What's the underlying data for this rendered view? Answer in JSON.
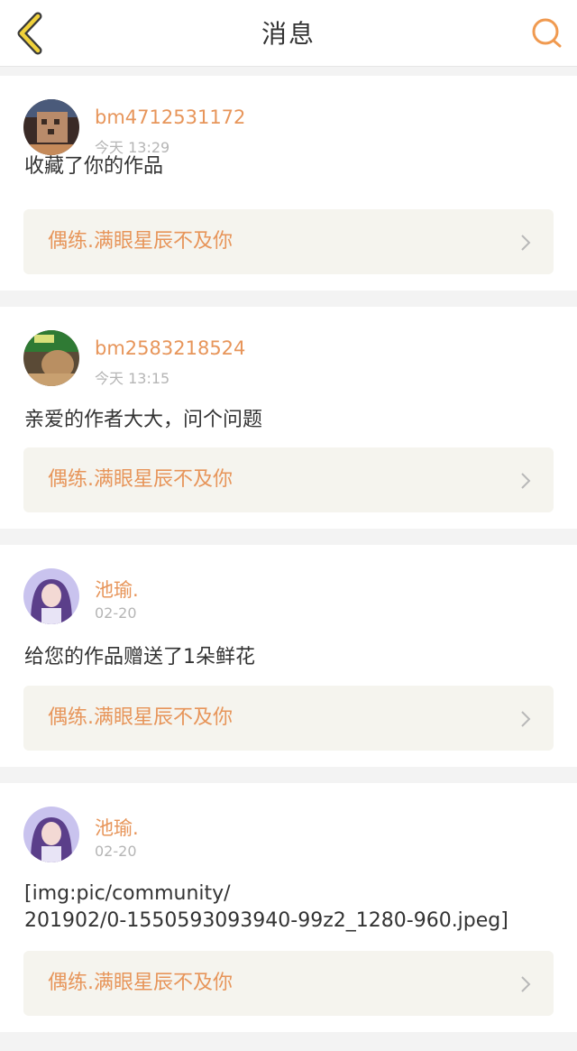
{
  "header": {
    "title": "消息",
    "back_icon": "chevron-left-icon",
    "search_icon": "search-icon",
    "accent_color": "#e7955a"
  },
  "messages": [
    {
      "username": "bm4712531172",
      "time": "今天 13:29",
      "text": "收藏了你的作品",
      "work_title": "偶练.满眼星辰不及你"
    },
    {
      "username": "bm2583218524",
      "time": "今天 13:15",
      "text": "亲爱的作者大大，问个问题",
      "work_title": "偶练.满眼星辰不及你"
    },
    {
      "username": "池瑜.",
      "time": "02-20",
      "text": "给您的作品赠送了1朵鲜花",
      "work_title": "偶练.满眼星辰不及你"
    },
    {
      "username": "池瑜.",
      "time": "02-20",
      "text_line1": "[img:pic/community/",
      "text_line2": "201902/0-1550593093940-99z2_1280-960.jpeg]",
      "work_title": "偶练.满眼星辰不及你"
    }
  ]
}
